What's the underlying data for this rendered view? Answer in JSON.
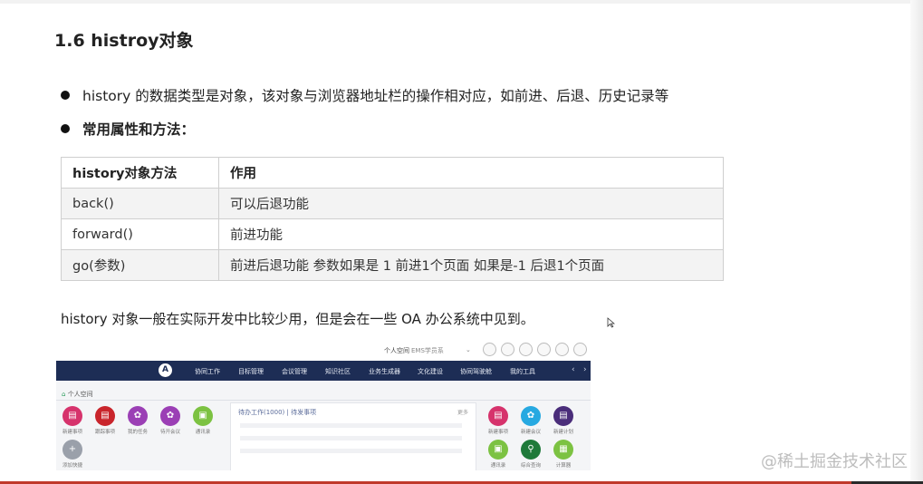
{
  "heading": "1.6 histroy对象",
  "bullets": [
    "history 的数据类型是对象，该对象与浏览器地址栏的操作相对应，如前进、后退、历史记录等",
    "常用属性和方法："
  ],
  "table": {
    "headers": [
      "history对象方法",
      "作用"
    ],
    "rows": [
      [
        "back()",
        "可以后退功能"
      ],
      [
        "forward()",
        "前进功能"
      ],
      [
        "go(参数)",
        "前进后退功能 参数如果是 1 前进1个页面 如果是-1 后退1个页面"
      ]
    ]
  },
  "paragraph": "history 对象一般在实际开发中比较少用，但是会在一些 OA 办公系统中见到。",
  "oa": {
    "top_links": [
      "个人空间",
      "EMS学员系"
    ],
    "nav": [
      "协同工作",
      "目标管理",
      "会议管理",
      "知识社区",
      "业务生成器",
      "文化建设",
      "协同驾驶舱",
      "我的工具"
    ],
    "logo": "A",
    "crumb": "个人空间",
    "left_icons": [
      "新建事项",
      "跟踪事项",
      "我的任务",
      "待开会议",
      "通讯录"
    ],
    "add_label": "添加快捷",
    "panel_tabs": "待办工作(1000)  |  待发事项",
    "panel_more": "更多",
    "right_icons": [
      "新建事项",
      "新建会议",
      "新建计划",
      "通讯录",
      "综合查询",
      "计算器"
    ],
    "colors": {
      "nav": "#1d2d55",
      "pink": "#d6336c",
      "red": "#c9252c",
      "purple": "#9b3fb5",
      "green": "#7cc242",
      "cyan": "#27a9e1",
      "navy": "#4a2d7a",
      "darkgreen": "#1f7a3a",
      "gray": "#9aa0aa"
    }
  },
  "watermark": "@稀土掘金技术社区"
}
